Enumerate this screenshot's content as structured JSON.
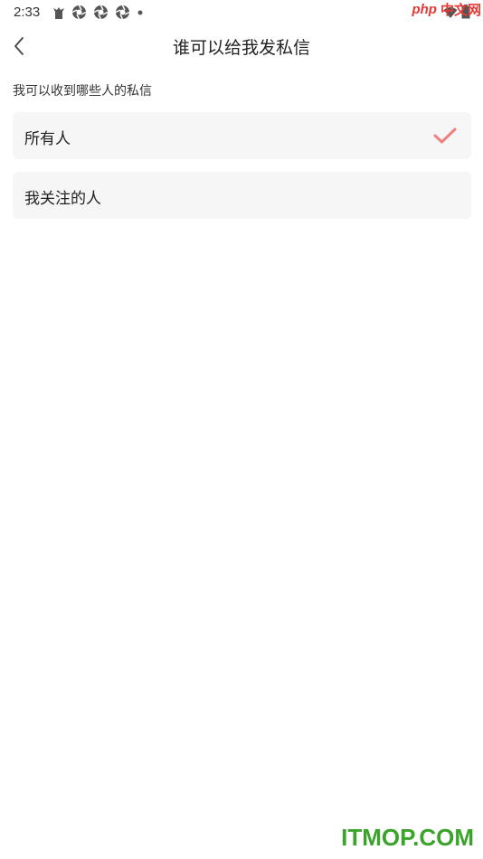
{
  "status_bar": {
    "time": "2:33",
    "icons": [
      "notification-app-icon",
      "aperture-icon",
      "aperture-icon",
      "aperture-icon",
      "dot-icon"
    ],
    "right_icons": [
      "wifi-icon",
      "battery-icon"
    ]
  },
  "watermark_top": {
    "php": "php",
    "cn": "中文网"
  },
  "nav": {
    "back_icon": "chevron-left-icon",
    "title": "谁可以给我发私信"
  },
  "section": {
    "label": "我可以收到哪些人的私信"
  },
  "options": [
    {
      "label": "所有人",
      "selected": true
    },
    {
      "label": "我关注的人",
      "selected": false
    }
  ],
  "colors": {
    "check": "#f08080",
    "option_bg": "#f6f6f6",
    "watermark_green": "#3aa32a",
    "watermark_red": "#e53935"
  },
  "watermark_bottom": "ITMOP.COM"
}
